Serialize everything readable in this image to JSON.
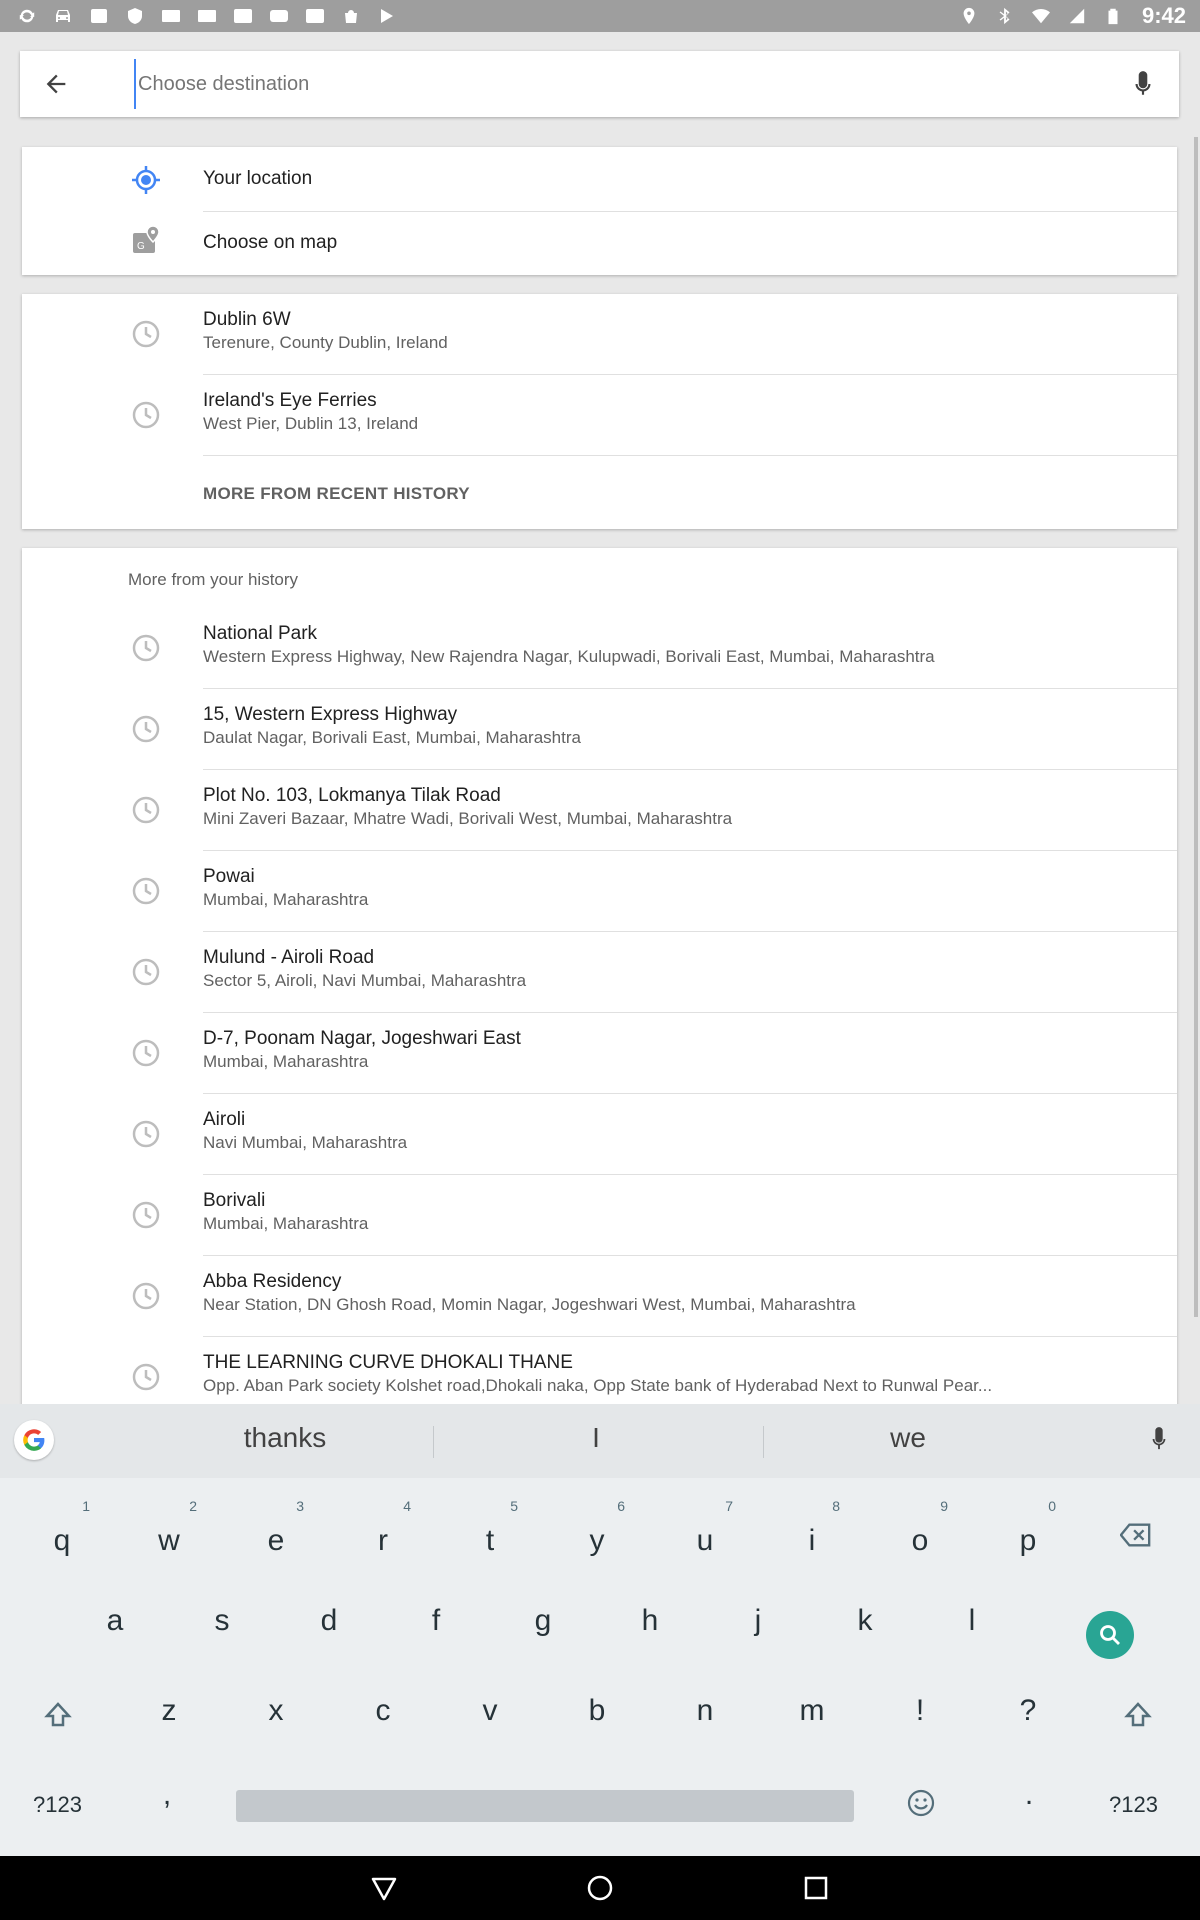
{
  "status_bar": {
    "left_icons": [
      "sync-icon",
      "car-icon",
      "image-icon",
      "shield-icon",
      "card-icon",
      "card-icon",
      "myntra-icon",
      "youtube-icon",
      "myntra-icon",
      "bag-icon",
      "play-store-icon"
    ],
    "right_icons": [
      "location-icon",
      "bluetooth-icon",
      "wifi-icon",
      "signal-icon",
      "battery-icon"
    ],
    "time": "9:42"
  },
  "search": {
    "placeholder": "Choose destination",
    "value": ""
  },
  "quick_options": [
    {
      "label": "Your location",
      "icon": "my-location-icon"
    },
    {
      "label": "Choose on map",
      "icon": "map-pin-icon"
    }
  ],
  "recent": {
    "items": [
      {
        "title": "Dublin 6W",
        "subtitle": "Terenure, County Dublin, Ireland"
      },
      {
        "title": "Ireland's Eye Ferries",
        "subtitle": "West Pier, Dublin 13, Ireland"
      }
    ],
    "more_label": "MORE FROM RECENT HISTORY"
  },
  "history": {
    "header": "More from your history",
    "items": [
      {
        "title": "National Park",
        "subtitle": "Western Express Highway, New Rajendra Nagar, Kulupwadi, Borivali East, Mumbai, Maharashtra"
      },
      {
        "title": "15, Western Express Highway",
        "subtitle": "Daulat Nagar, Borivali East, Mumbai, Maharashtra"
      },
      {
        "title": "Plot No. 103, Lokmanya Tilak Road",
        "subtitle": "Mini Zaveri Bazaar, Mhatre Wadi, Borivali West, Mumbai, Maharashtra"
      },
      {
        "title": "Powai",
        "subtitle": "Mumbai, Maharashtra"
      },
      {
        "title": "Mulund - Airoli Road",
        "subtitle": "Sector 5, Airoli, Navi Mumbai, Maharashtra"
      },
      {
        "title": "D-7, Poonam Nagar, Jogeshwari East",
        "subtitle": "Mumbai, Maharashtra"
      },
      {
        "title": "Airoli",
        "subtitle": "Navi Mumbai, Maharashtra"
      },
      {
        "title": "Borivali",
        "subtitle": "Mumbai, Maharashtra"
      },
      {
        "title": "Abba Residency",
        "subtitle": "Near Station, DN Ghosh Road, Momin Nagar, Jogeshwari West, Mumbai, Maharashtra"
      },
      {
        "title": "THE LEARNING CURVE DHOKALI THANE",
        "subtitle": "Opp. Aban Park society Kolshet road,Dhokali naka, Opp State bank of Hyderabad Next to Runwal Pear..."
      }
    ]
  },
  "keyboard": {
    "suggestions": [
      "thanks",
      "I",
      "we"
    ],
    "row1": [
      "q",
      "w",
      "e",
      "r",
      "t",
      "y",
      "u",
      "i",
      "o",
      "p"
    ],
    "row1_hints": [
      "1",
      "2",
      "3",
      "4",
      "5",
      "6",
      "7",
      "8",
      "9",
      "0"
    ],
    "row2": [
      "a",
      "s",
      "d",
      "f",
      "g",
      "h",
      "j",
      "k",
      "l"
    ],
    "row3": [
      "z",
      "x",
      "c",
      "v",
      "b",
      "n",
      "m",
      "!",
      "?"
    ],
    "symbols_label": "?123",
    "comma": ",",
    "period": "."
  },
  "colors": {
    "accent": "#4285f4",
    "search_key": "#29a594",
    "status_bar": "#9e9e9e"
  }
}
